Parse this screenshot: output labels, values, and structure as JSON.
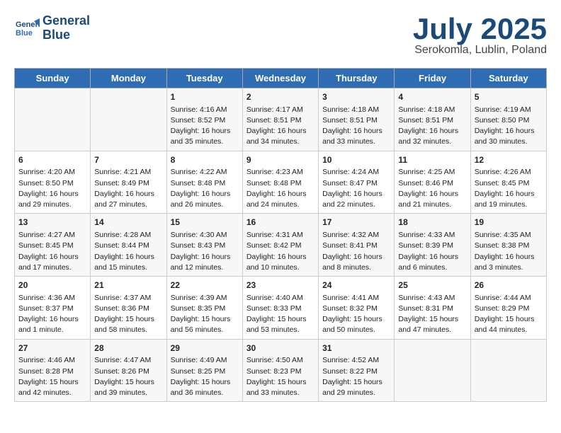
{
  "header": {
    "logo_line1": "General",
    "logo_line2": "Blue",
    "month": "July 2025",
    "location": "Serokomla, Lublin, Poland"
  },
  "days_of_week": [
    "Sunday",
    "Monday",
    "Tuesday",
    "Wednesday",
    "Thursday",
    "Friday",
    "Saturday"
  ],
  "weeks": [
    [
      {
        "day": "",
        "info": ""
      },
      {
        "day": "",
        "info": ""
      },
      {
        "day": "1",
        "info": "Sunrise: 4:16 AM\nSunset: 8:52 PM\nDaylight: 16 hours and 35 minutes."
      },
      {
        "day": "2",
        "info": "Sunrise: 4:17 AM\nSunset: 8:51 PM\nDaylight: 16 hours and 34 minutes."
      },
      {
        "day": "3",
        "info": "Sunrise: 4:18 AM\nSunset: 8:51 PM\nDaylight: 16 hours and 33 minutes."
      },
      {
        "day": "4",
        "info": "Sunrise: 4:18 AM\nSunset: 8:51 PM\nDaylight: 16 hours and 32 minutes."
      },
      {
        "day": "5",
        "info": "Sunrise: 4:19 AM\nSunset: 8:50 PM\nDaylight: 16 hours and 30 minutes."
      }
    ],
    [
      {
        "day": "6",
        "info": "Sunrise: 4:20 AM\nSunset: 8:50 PM\nDaylight: 16 hours and 29 minutes."
      },
      {
        "day": "7",
        "info": "Sunrise: 4:21 AM\nSunset: 8:49 PM\nDaylight: 16 hours and 27 minutes."
      },
      {
        "day": "8",
        "info": "Sunrise: 4:22 AM\nSunset: 8:48 PM\nDaylight: 16 hours and 26 minutes."
      },
      {
        "day": "9",
        "info": "Sunrise: 4:23 AM\nSunset: 8:48 PM\nDaylight: 16 hours and 24 minutes."
      },
      {
        "day": "10",
        "info": "Sunrise: 4:24 AM\nSunset: 8:47 PM\nDaylight: 16 hours and 22 minutes."
      },
      {
        "day": "11",
        "info": "Sunrise: 4:25 AM\nSunset: 8:46 PM\nDaylight: 16 hours and 21 minutes."
      },
      {
        "day": "12",
        "info": "Sunrise: 4:26 AM\nSunset: 8:45 PM\nDaylight: 16 hours and 19 minutes."
      }
    ],
    [
      {
        "day": "13",
        "info": "Sunrise: 4:27 AM\nSunset: 8:45 PM\nDaylight: 16 hours and 17 minutes."
      },
      {
        "day": "14",
        "info": "Sunrise: 4:28 AM\nSunset: 8:44 PM\nDaylight: 16 hours and 15 minutes."
      },
      {
        "day": "15",
        "info": "Sunrise: 4:30 AM\nSunset: 8:43 PM\nDaylight: 16 hours and 12 minutes."
      },
      {
        "day": "16",
        "info": "Sunrise: 4:31 AM\nSunset: 8:42 PM\nDaylight: 16 hours and 10 minutes."
      },
      {
        "day": "17",
        "info": "Sunrise: 4:32 AM\nSunset: 8:41 PM\nDaylight: 16 hours and 8 minutes."
      },
      {
        "day": "18",
        "info": "Sunrise: 4:33 AM\nSunset: 8:39 PM\nDaylight: 16 hours and 6 minutes."
      },
      {
        "day": "19",
        "info": "Sunrise: 4:35 AM\nSunset: 8:38 PM\nDaylight: 16 hours and 3 minutes."
      }
    ],
    [
      {
        "day": "20",
        "info": "Sunrise: 4:36 AM\nSunset: 8:37 PM\nDaylight: 16 hours and 1 minute."
      },
      {
        "day": "21",
        "info": "Sunrise: 4:37 AM\nSunset: 8:36 PM\nDaylight: 15 hours and 58 minutes."
      },
      {
        "day": "22",
        "info": "Sunrise: 4:39 AM\nSunset: 8:35 PM\nDaylight: 15 hours and 56 minutes."
      },
      {
        "day": "23",
        "info": "Sunrise: 4:40 AM\nSunset: 8:33 PM\nDaylight: 15 hours and 53 minutes."
      },
      {
        "day": "24",
        "info": "Sunrise: 4:41 AM\nSunset: 8:32 PM\nDaylight: 15 hours and 50 minutes."
      },
      {
        "day": "25",
        "info": "Sunrise: 4:43 AM\nSunset: 8:31 PM\nDaylight: 15 hours and 47 minutes."
      },
      {
        "day": "26",
        "info": "Sunrise: 4:44 AM\nSunset: 8:29 PM\nDaylight: 15 hours and 44 minutes."
      }
    ],
    [
      {
        "day": "27",
        "info": "Sunrise: 4:46 AM\nSunset: 8:28 PM\nDaylight: 15 hours and 42 minutes."
      },
      {
        "day": "28",
        "info": "Sunrise: 4:47 AM\nSunset: 8:26 PM\nDaylight: 15 hours and 39 minutes."
      },
      {
        "day": "29",
        "info": "Sunrise: 4:49 AM\nSunset: 8:25 PM\nDaylight: 15 hours and 36 minutes."
      },
      {
        "day": "30",
        "info": "Sunrise: 4:50 AM\nSunset: 8:23 PM\nDaylight: 15 hours and 33 minutes."
      },
      {
        "day": "31",
        "info": "Sunrise: 4:52 AM\nSunset: 8:22 PM\nDaylight: 15 hours and 29 minutes."
      },
      {
        "day": "",
        "info": ""
      },
      {
        "day": "",
        "info": ""
      }
    ]
  ]
}
